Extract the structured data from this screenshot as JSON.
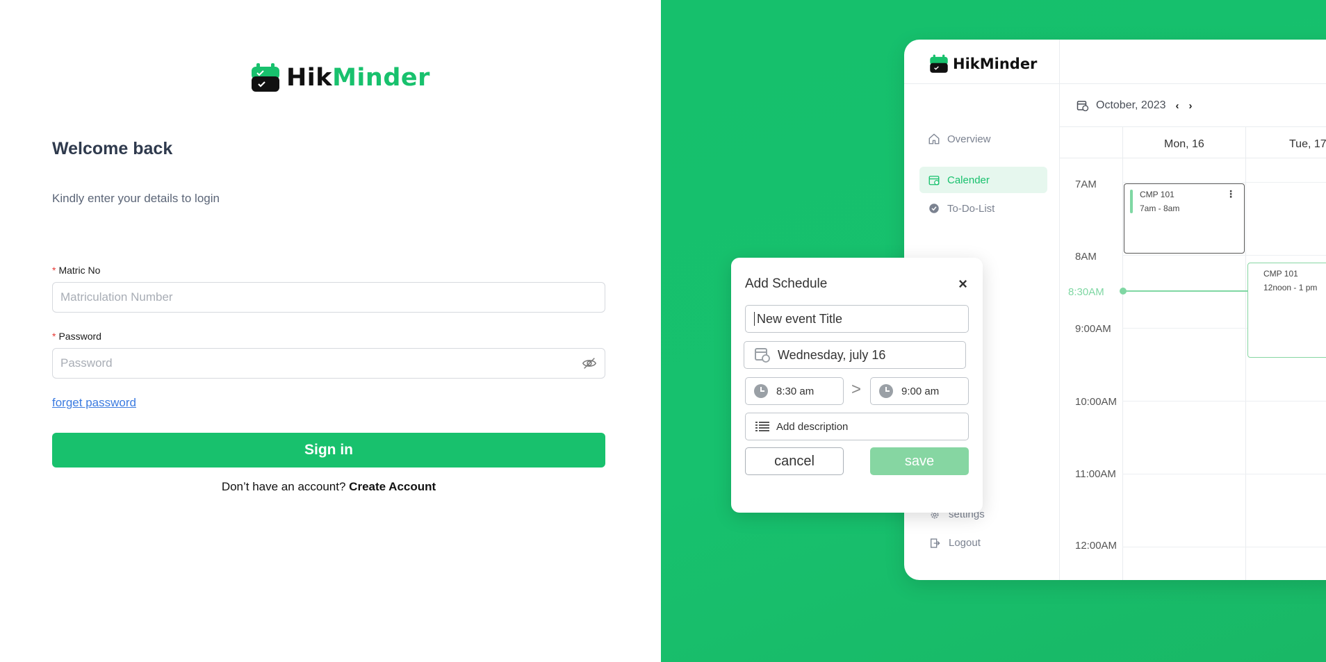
{
  "login": {
    "brand_part1": "Hik",
    "brand_part2": "Minder",
    "welcome": "Welcome back",
    "subtitle": "Kindly enter your details to login",
    "matric_label": "Matric No",
    "matric_placeholder": "Matriculation Number",
    "password_label": "Password",
    "password_placeholder": "Password",
    "forget_password": "forget password",
    "sign_in": "Sign in",
    "no_account": "Don’t have an account?",
    "create_account": "Create Account"
  },
  "app": {
    "brand": "HikMinder",
    "nav": [
      {
        "label": "Overview",
        "icon": "home-icon"
      },
      {
        "label": "Calender",
        "icon": "calendar-icon",
        "active": true
      },
      {
        "label": "To-Do-List",
        "icon": "check-circle-icon"
      }
    ],
    "bottom_nav": [
      {
        "label": "settings",
        "icon": "gear-icon"
      },
      {
        "label": "Logout",
        "icon": "logout-icon"
      }
    ],
    "month": "October, 2023",
    "days": [
      "Mon, 16",
      "Tue, 17"
    ],
    "times": [
      "7AM",
      "8AM",
      "8:30AM",
      "9:00AM",
      "10:00AM",
      "11:00AM",
      "12:00AM"
    ],
    "events": [
      {
        "title": "CMP 101",
        "time": "7am - 8am"
      },
      {
        "title": "CMP 101",
        "time": "12noon - 1 pm"
      }
    ]
  },
  "modal": {
    "title": "Add Schedule",
    "event_title": "New event Title",
    "date": "Wednesday, july 16",
    "start_time": "8:30 am",
    "end_time": "9:00 am",
    "description_placeholder": "Add description",
    "cancel": "cancel",
    "save": "save",
    "separator": ">"
  },
  "colors": {
    "brand_green": "#18c16d",
    "light_green": "#86d6a2",
    "link_blue": "#3b7be0"
  }
}
